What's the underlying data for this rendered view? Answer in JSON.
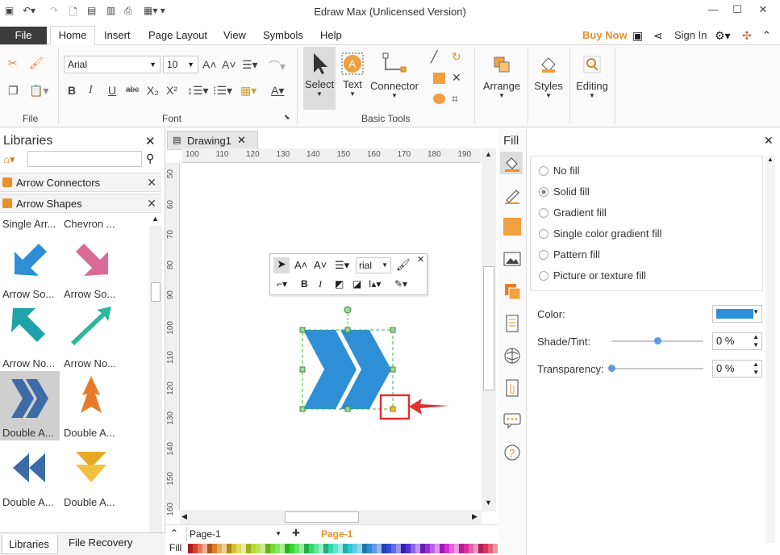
{
  "window": {
    "title": "Edraw Max (Unlicensed Version)"
  },
  "menu": {
    "file": "File",
    "tabs": [
      "Home",
      "Insert",
      "Page Layout",
      "View",
      "Symbols",
      "Help"
    ],
    "buy_now": "Buy Now",
    "sign_in": "Sign In"
  },
  "ribbon": {
    "groups": {
      "file": "File",
      "font": "Font",
      "basic_tools": "Basic Tools"
    },
    "font_name": "Arial",
    "font_size": "10",
    "tools": {
      "select": "Select",
      "text": "Text",
      "connector": "Connector"
    },
    "arrange": "Arrange",
    "styles": "Styles",
    "editing": "Editing"
  },
  "libraries": {
    "title": "Libraries",
    "sections": [
      "Arrow Connectors",
      "Arrow Shapes"
    ],
    "shapes": [
      {
        "label": "Single Arr...",
        "color": "#2e8fd6"
      },
      {
        "label": "Chevron ...",
        "color": "#d96a95"
      },
      {
        "label": "Arrow So...",
        "color": "#2e8fd6"
      },
      {
        "label": "Arrow So...",
        "color": "#d96a95"
      },
      {
        "label": "Arrow No...",
        "color": "#1fa3a8"
      },
      {
        "label": "Arrow No...",
        "color": "#2cb89a"
      },
      {
        "label": "Double A...",
        "color": "#3c6ba8"
      },
      {
        "label": "Double A...",
        "color": "#e87b2a"
      },
      {
        "label": "Double A...",
        "color": "#3c6ba8"
      },
      {
        "label": "Double A...",
        "color": "#e8a92a"
      }
    ]
  },
  "document": {
    "tab": "Drawing1"
  },
  "rulers": {
    "h": [
      "100",
      "110",
      "120",
      "130",
      "140",
      "150",
      "160",
      "170",
      "180",
      "190"
    ],
    "v": [
      "50",
      "60",
      "70",
      "80",
      "90",
      "100",
      "110",
      "120",
      "130",
      "140",
      "150",
      "160"
    ]
  },
  "mini_toolbar": {
    "font": "rial"
  },
  "fill_panel": {
    "title": "Fill",
    "options": [
      "No fill",
      "Solid fill",
      "Gradient fill",
      "Single color gradient fill",
      "Pattern fill",
      "Picture or texture fill"
    ],
    "selected": "Solid fill",
    "color_label": "Color:",
    "color_value": "#2e8fd6",
    "shade_label": "Shade/Tint:",
    "shade_value": "0 %",
    "shade_fraction": 0.5,
    "transparency_label": "Transparency:",
    "transparency_value": "0 %",
    "transparency_fraction": 0.0
  },
  "bottom": {
    "tabs": [
      "Libraries",
      "File Recovery"
    ],
    "page_select": "Page-1",
    "page_tab": "Page-1",
    "fill_label": "Fill"
  },
  "colors": {
    "accent": "#e8902a",
    "shape_blue": "#2e8fd6",
    "highlight_red": "#e03030"
  }
}
